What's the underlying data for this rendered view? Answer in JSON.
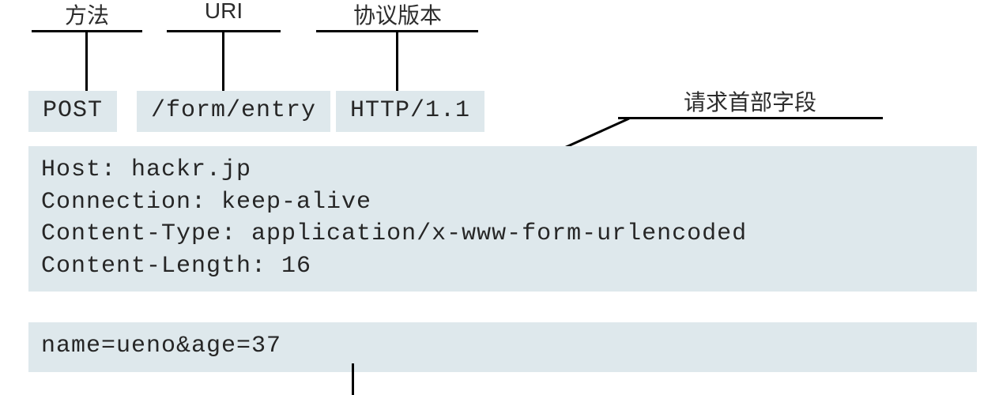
{
  "labels": {
    "method": "方法",
    "uri": "URI",
    "protocol": "协议版本",
    "headers": "请求首部字段"
  },
  "requestLine": {
    "method": "POST",
    "uri": "/form/entry",
    "protocol": "HTTP/1.1"
  },
  "headersBlock": "Host: hackr.jp\nConnection: keep-alive\nContent-Type: application/x-www-form-urlencoded\nContent-Length: 16",
  "bodyBlock": "name=ueno&age=37"
}
